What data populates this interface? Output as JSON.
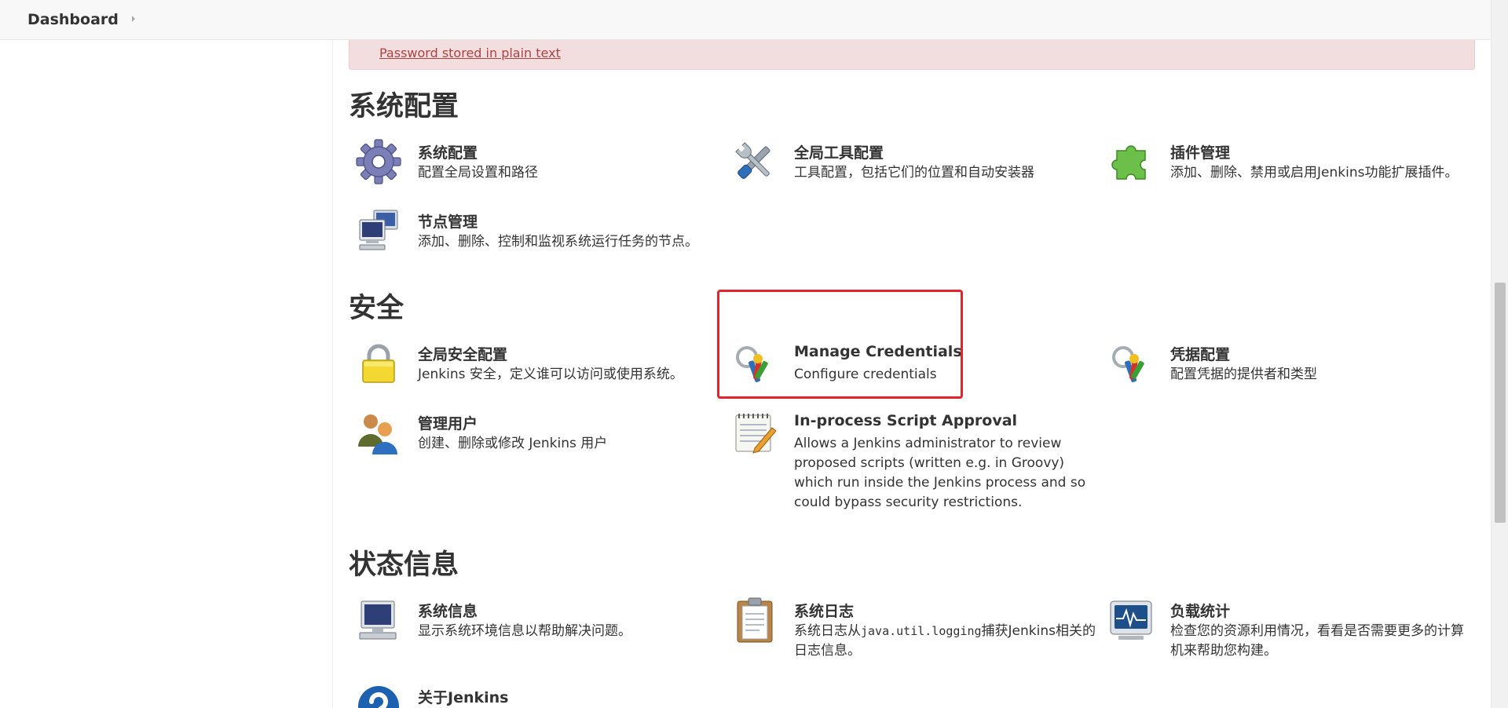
{
  "breadcrumb": {
    "home": "Dashboard"
  },
  "alert": {
    "link_text": "Password stored in plain text"
  },
  "sections": {
    "system_config": {
      "title": "系统配置",
      "items": [
        {
          "title": "系统配置",
          "desc": "配置全局设置和路径",
          "icon": "gear-icon"
        },
        {
          "title": "全局工具配置",
          "desc": "工具配置，包括它们的位置和自动安装器",
          "icon": "tools-icon"
        },
        {
          "title": "插件管理",
          "desc": "添加、删除、禁用或启用Jenkins功能扩展插件。",
          "icon": "puzzle-icon"
        },
        {
          "title": "节点管理",
          "desc": "添加、删除、控制和监视系统运行任务的节点。",
          "icon": "computers-icon"
        }
      ]
    },
    "security": {
      "title": "安全",
      "items": [
        {
          "title": "全局安全配置",
          "desc": "Jenkins 安全，定义谁可以访问或使用系统。",
          "icon": "lock-icon"
        },
        {
          "title": "Manage Credentials",
          "desc": "Configure credentials",
          "icon": "keys-icon"
        },
        {
          "title": "凭据配置",
          "desc": "配置凭据的提供者和类型",
          "icon": "keys-icon"
        },
        {
          "title": "管理用户",
          "desc": "创建、删除或修改 Jenkins 用户",
          "icon": "users-icon"
        },
        {
          "title": "In-process Script Approval",
          "desc": "Allows a Jenkins administrator to review proposed scripts (written e.g. in Groovy) which run inside the Jenkins process and so could bypass security restrictions.",
          "icon": "notepad-icon"
        }
      ]
    },
    "status": {
      "title": "状态信息",
      "items": [
        {
          "title": "系统信息",
          "desc": "显示系统环境信息以帮助解决问题。",
          "icon": "computer-icon"
        },
        {
          "title": "系统日志",
          "desc_pre": "系统日志从",
          "desc_code": "java.util.logging",
          "desc_post": "捕获Jenkins相关的日志信息。",
          "icon": "clipboard-icon"
        },
        {
          "title": "负载统计",
          "desc": "检查您的资源利用情况，看看是否需要更多的计算机来帮助您构建。",
          "icon": "monitor-icon"
        },
        {
          "title": "关于Jenkins",
          "icon": "help-icon"
        }
      ]
    }
  },
  "colors": {
    "alert_bg": "#f2dede",
    "alert_text": "#a94442",
    "highlight": "#e5232a"
  }
}
